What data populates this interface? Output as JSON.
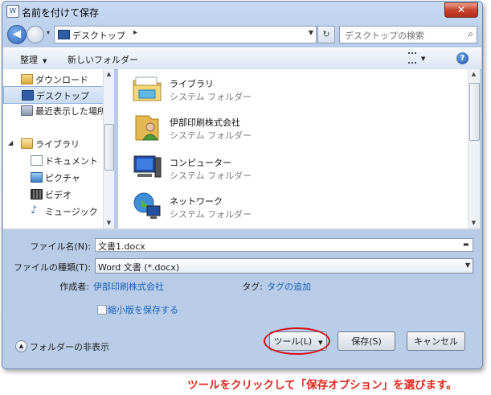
{
  "window": {
    "title": "名前を付けて保存",
    "app_icon": "doc-icon"
  },
  "address": {
    "location": "デスクトップ",
    "chevron": "▸",
    "search_placeholder": "デスクトップの検索"
  },
  "toolbar": {
    "organize": "整理",
    "new_folder": "新しいフォルダー",
    "help": "?"
  },
  "nav": {
    "items": [
      {
        "label": "ダウンロード",
        "icon": "download-folder-icon"
      },
      {
        "label": "デスクトップ",
        "icon": "desktop-icon",
        "selected": true
      },
      {
        "label": "最近表示した場所",
        "icon": "recent-places-icon"
      },
      {
        "label": "ライブラリ",
        "icon": "library-icon"
      },
      {
        "label": "ドキュメント",
        "icon": "documents-icon"
      },
      {
        "label": "ピクチャ",
        "icon": "pictures-icon"
      },
      {
        "label": "ビデオ",
        "icon": "videos-icon"
      },
      {
        "label": "ミュージック",
        "icon": "music-icon"
      }
    ]
  },
  "files": [
    {
      "name": "ライブラリ",
      "type": "システム フォルダー",
      "icon": "library-folder-icon"
    },
    {
      "name": "伊部印刷株式会社",
      "type": "システム フォルダー",
      "icon": "user-folder-icon"
    },
    {
      "name": "コンピューター",
      "type": "システム フォルダー",
      "icon": "computer-icon"
    },
    {
      "name": "ネットワーク",
      "type": "システム フォルダー",
      "icon": "network-icon"
    }
  ],
  "form": {
    "filename_label": "ファイル名(N):",
    "filename_value": "文書1.docx",
    "filetype_label": "ファイルの種類(T):",
    "filetype_value": "Word 文書 (*.docx)",
    "author_label": "作成者:",
    "author_value": "伊部印刷株式会社",
    "tags_label": "タグ:",
    "tags_value": "タグの追加",
    "thumbnail_label": "縮小版を保存する"
  },
  "footer": {
    "hide_folders": "フォルダーの非表示",
    "tools": "ツール(L)",
    "save": "保存(S)",
    "cancel": "キャンセル"
  },
  "caption": "ツールをクリックして「保存オプション」を選びます。",
  "colors": {
    "accent_link": "#1a5fb4",
    "highlight": "#d80c18",
    "caption": "#e1261c"
  }
}
